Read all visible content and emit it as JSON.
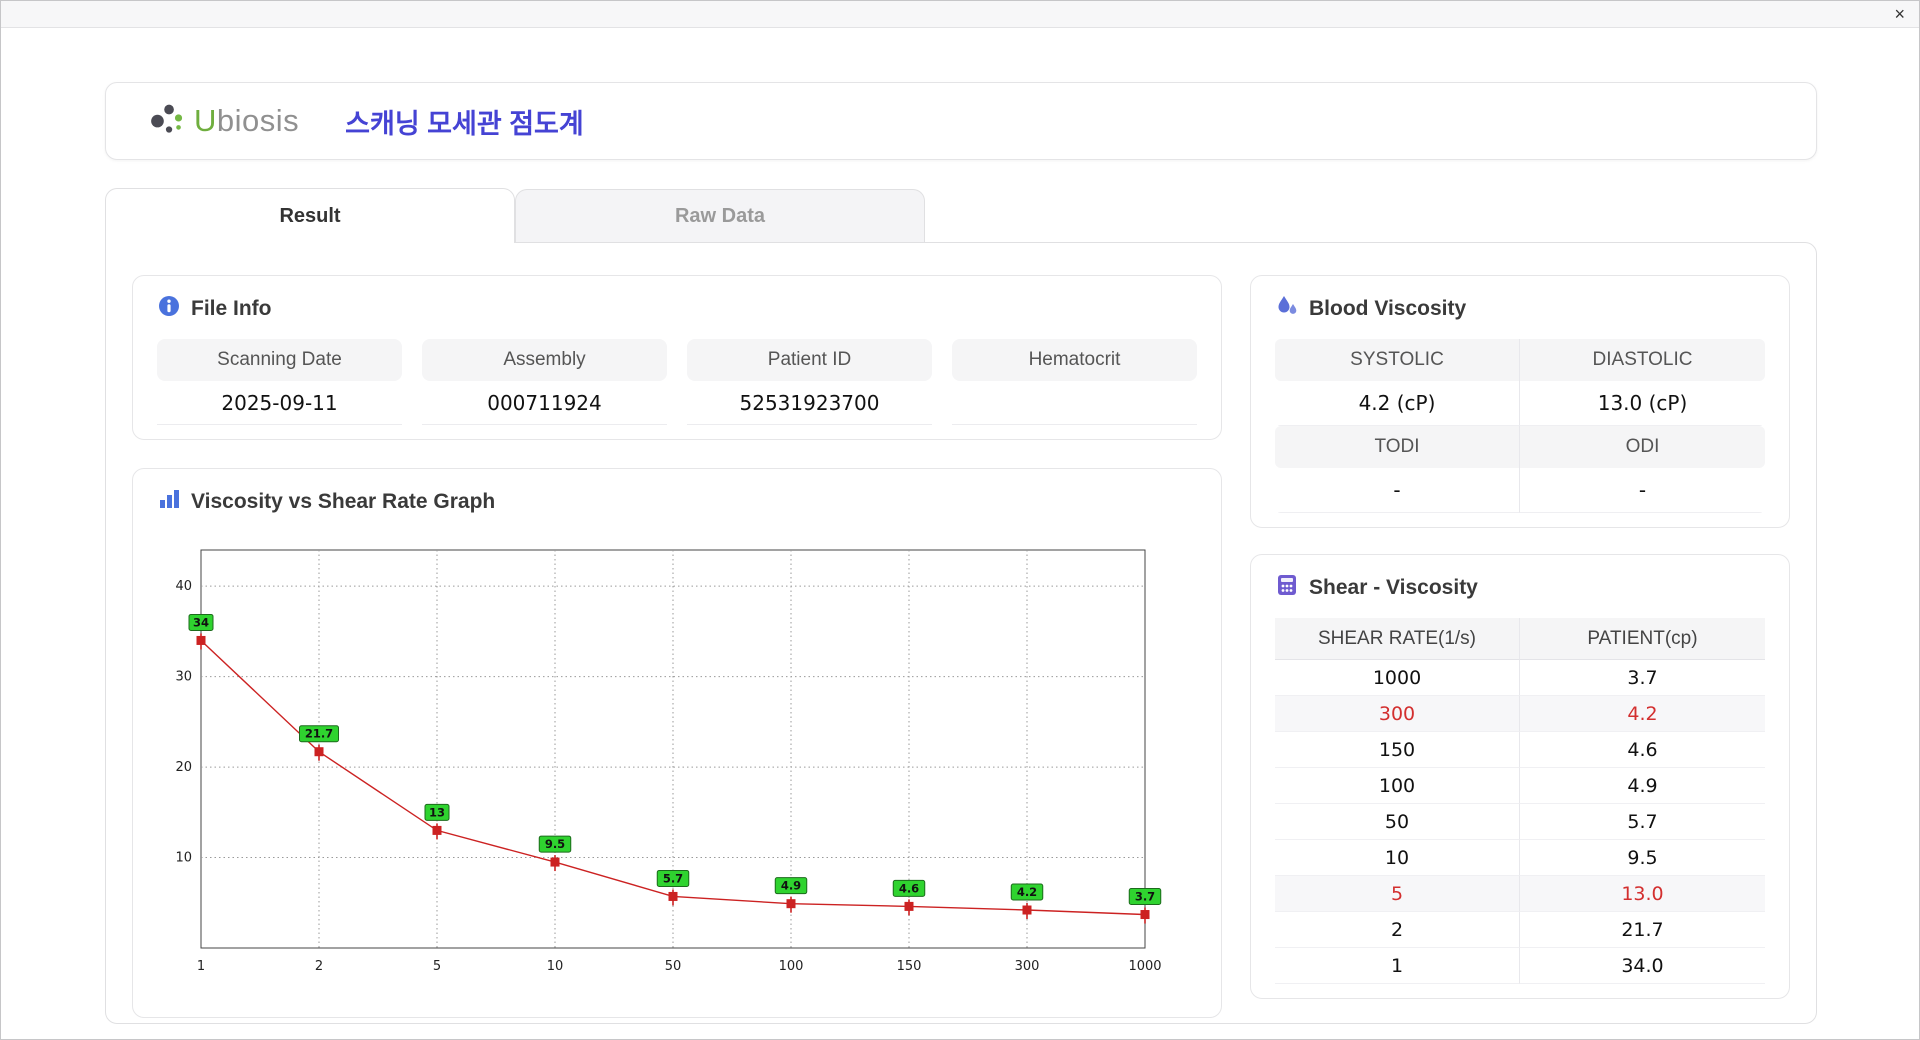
{
  "window": {
    "close_glyph": "×"
  },
  "header": {
    "logo_u": "U",
    "logo_rest": "biosis",
    "title": "스캐닝 모세관 점도계"
  },
  "tabs": [
    {
      "label": "Result",
      "active": true
    },
    {
      "label": "Raw Data",
      "active": false
    }
  ],
  "file_info": {
    "title": "File Info",
    "fields": [
      {
        "label": "Scanning Date",
        "value": "2025-09-11"
      },
      {
        "label": "Assembly",
        "value": "000711924"
      },
      {
        "label": "Patient ID",
        "value": "52531923700"
      },
      {
        "label": "Hematocrit",
        "value": ""
      }
    ]
  },
  "blood_viscosity": {
    "title": "Blood Viscosity",
    "systolic_label": "SYSTOLIC",
    "systolic_value": "4.2 (cP)",
    "diastolic_label": "DIASTOLIC",
    "diastolic_value": "13.0 (cP)",
    "todi_label": "TODI",
    "todi_value": "-",
    "odi_label": "ODI",
    "odi_value": "-"
  },
  "graph": {
    "title": "Viscosity vs Shear Rate Graph"
  },
  "chart_data": {
    "type": "line",
    "title": "Viscosity vs Shear Rate Graph",
    "x_axis": "Shear rate (1/s), category-spaced log-like ticks",
    "x_ticks": [
      "1",
      "2",
      "5",
      "10",
      "50",
      "100",
      "150",
      "300",
      "1000"
    ],
    "x": [
      1,
      2,
      5,
      10,
      50,
      100,
      150,
      300,
      1000
    ],
    "values": [
      34,
      21.7,
      13,
      9.5,
      5.7,
      4.9,
      4.6,
      4.2,
      3.7
    ],
    "point_labels": [
      "34",
      "21.7",
      "13",
      "9.5",
      "5.7",
      "4.9",
      "4.6",
      "4.2",
      "3.7"
    ],
    "y_ticks": [
      10,
      20,
      30,
      40
    ],
    "ylim": [
      0,
      44
    ],
    "grid": "dotted",
    "legend": "none",
    "line_color": "#cc2222",
    "marker_color": "#cc2222",
    "label_bg": "#2fd32f",
    "label_border": "#1c6b1c"
  },
  "shear_table": {
    "title": "Shear - Viscosity",
    "columns": [
      "SHEAR RATE(1/s)",
      "PATIENT(cp)"
    ],
    "rows": [
      {
        "rate": "1000",
        "patient": "3.7",
        "highlight": false
      },
      {
        "rate": "300",
        "patient": "4.2",
        "highlight": true
      },
      {
        "rate": "150",
        "patient": "4.6",
        "highlight": false
      },
      {
        "rate": "100",
        "patient": "4.9",
        "highlight": false
      },
      {
        "rate": "50",
        "patient": "5.7",
        "highlight": false
      },
      {
        "rate": "10",
        "patient": "9.5",
        "highlight": false
      },
      {
        "rate": "5",
        "patient": "13.0",
        "highlight": true
      },
      {
        "rate": "2",
        "patient": "21.7",
        "highlight": false
      },
      {
        "rate": "1",
        "patient": "34.0",
        "highlight": false
      }
    ]
  },
  "colors": {
    "accent_title": "#4543d4",
    "highlight_red": "#d32f2f",
    "icon_blue": "#4a72dd",
    "icon_drop_blue": "#5b6fd8",
    "icon_purple": "#6f5bd0",
    "logo_green": "#6fae3e",
    "logo_gray": "#909090",
    "chart_line": "#cc2222",
    "chart_label_green": "#2fd32f"
  }
}
